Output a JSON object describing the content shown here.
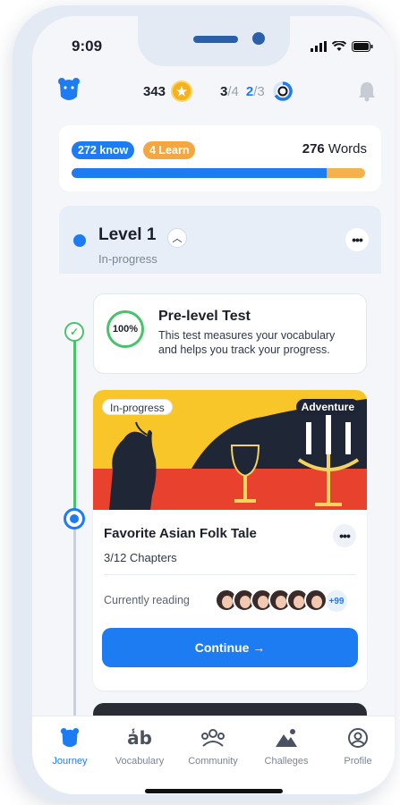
{
  "status": {
    "time": "9:09"
  },
  "header": {
    "coins": "343",
    "progress_a": "3",
    "progress_a_total": "/4",
    "progress_b": "2",
    "progress_b_total": "/3"
  },
  "words": {
    "know_label": "272 know",
    "learn_label": "4 Learn",
    "total_number": "276",
    "total_unit": " Words",
    "known_fraction": 0.87
  },
  "level": {
    "title": "Level 1",
    "status": "In-progress"
  },
  "pre_test": {
    "percent": "100%",
    "title": "Pre-level Test",
    "description": "This test measures your vocabulary and helps you track your progress."
  },
  "book": {
    "status_tag": "In-progress",
    "genre_tag": "Adventure",
    "title": "Favorite Asian Folk Tale",
    "chapters": "3/12 Chapters",
    "reading_label": "Currently reading",
    "readers_more": "+99",
    "continue_label": "Continue →"
  },
  "tabs": [
    {
      "label": "Journey",
      "icon": "bear-icon"
    },
    {
      "label": "Vocabulary",
      "icon": "vocabulary-icon"
    },
    {
      "label": "Community",
      "icon": "community-icon"
    },
    {
      "label": "Challeges",
      "icon": "mountain-flag-icon"
    },
    {
      "label": "Profile",
      "icon": "profile-icon"
    }
  ],
  "colors": {
    "accent": "#1d7cf2",
    "success": "#48c36b",
    "learn": "#f4a641"
  }
}
